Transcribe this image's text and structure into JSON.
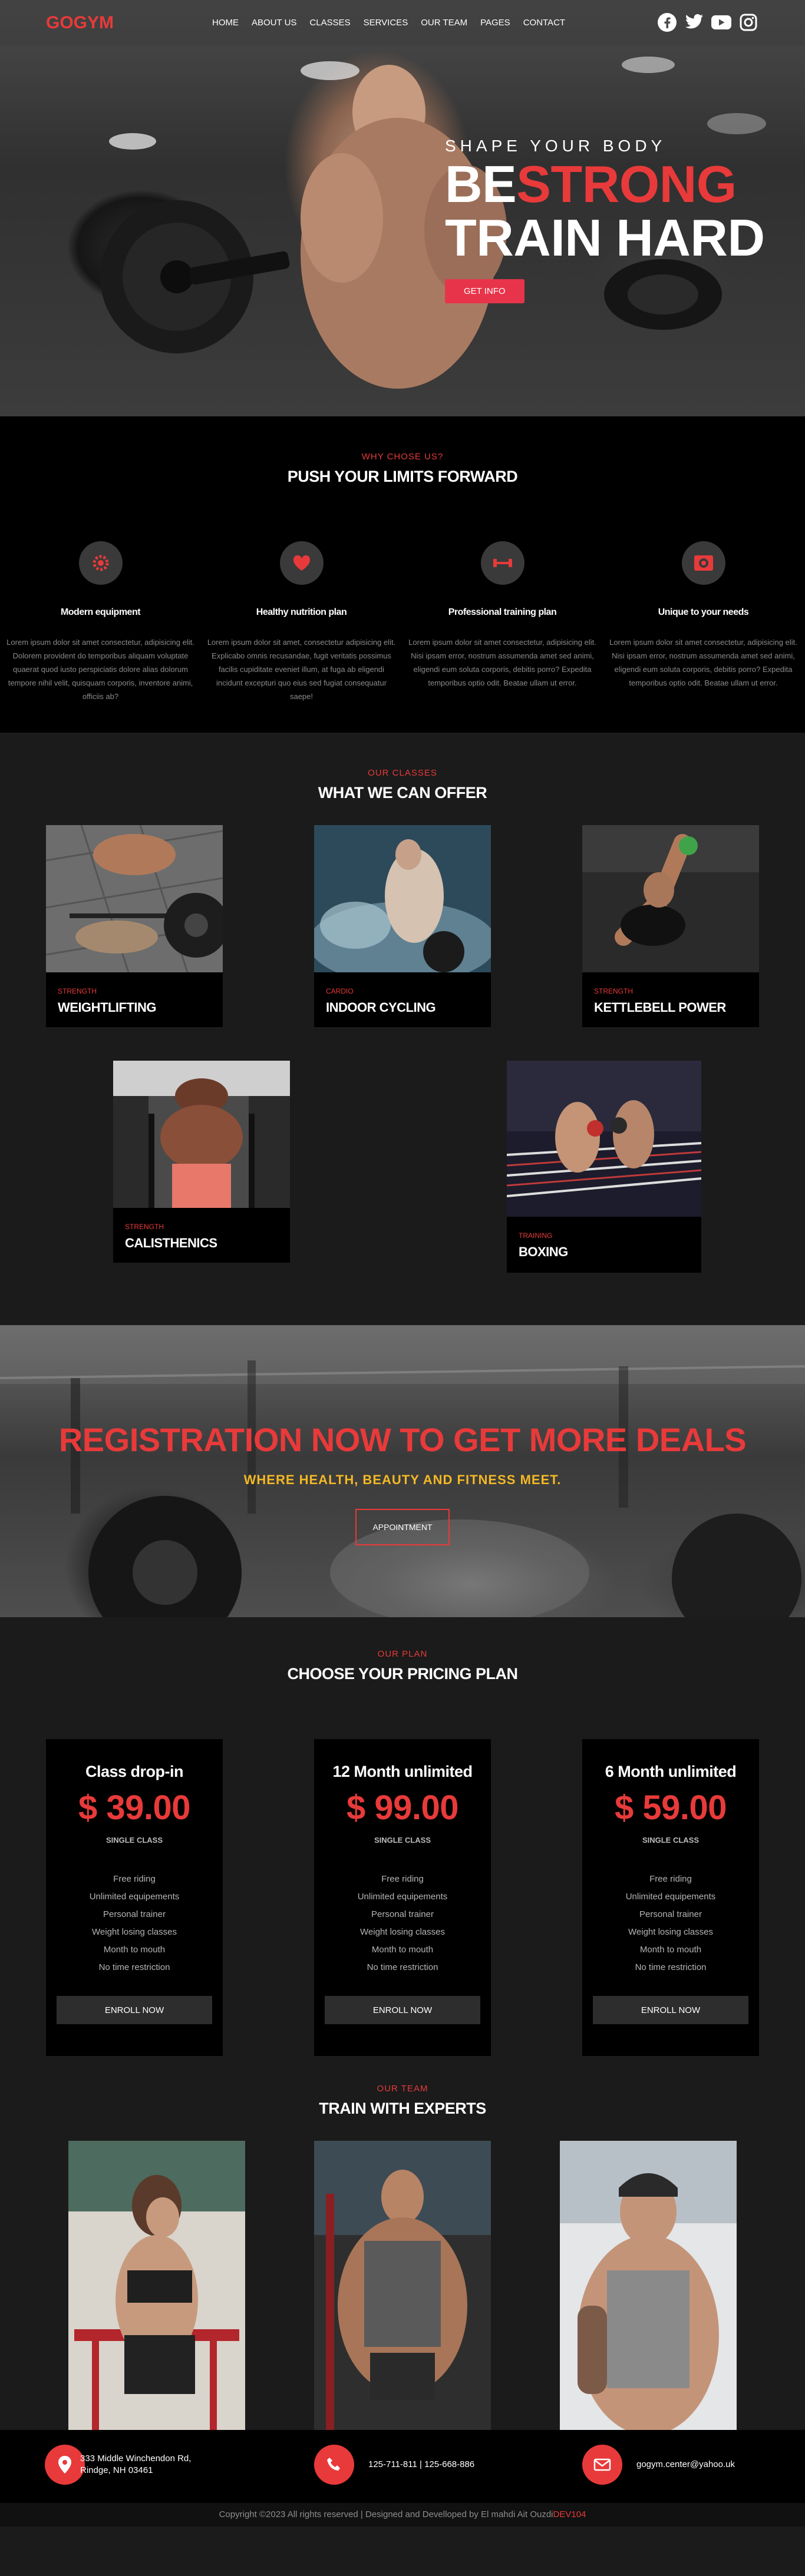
{
  "brand": {
    "logo": "GOGYM"
  },
  "nav": {
    "items": [
      "HOME",
      "ABOUT US",
      "CLASSES",
      "SERVICES",
      "OUR TEAM",
      "PAGES",
      "CONTACT"
    ],
    "social": [
      "facebook-icon",
      "twitter-icon",
      "youtube-icon",
      "instagram-icon"
    ]
  },
  "hero": {
    "kicker": "SHAPE YOUR BODY",
    "line1_a": "BE",
    "line1_b": "STRONG",
    "line2": "TRAIN HARD",
    "button": "GET INFO"
  },
  "why": {
    "kicker": "WHY CHOSE US?",
    "title": "PUSH YOUR LIMITS FORWARD",
    "features": [
      {
        "icon": "gear-icon",
        "title": "Modern equipment",
        "text": "Lorem ipsum dolor sit amet consectetur, adipisicing elit. Dolorem provident do temporibus aliquam voluptate quaerat quod iusto perspiciatis dolore alias dolorum tempore nihil velit, quisquam corporis, inventore animi, officiis ab?"
      },
      {
        "icon": "heart-icon",
        "title": "Healthy nutrition plan",
        "text": "Lorem ipsum dolor sit amet, consectetur adipisicing elit. Explicabo omnis recusandae, fugit veritatis possimus facilis cupiditate eveniet illum, at fuga ab eligendi incidunt excepturi quo eius sed fugiat consequatur saepe!"
      },
      {
        "icon": "dumbbell-icon",
        "title": "Professional training plan",
        "text": "Lorem ipsum dolor sit amet consectetur, adipisicing elit. Nisi ipsam error, nostrum assumenda amet sed animi, eligendi eum soluta corporis, debitis porro? Expedita temporibus optio odit. Beatae ullam ut error."
      },
      {
        "icon": "target-icon",
        "title": "Unique to your needs",
        "text": "Lorem ipsum dolor sit amet consectetur, adipisicing elit. Nisi ipsam error, nostrum assumenda amet sed animi, eligendi eum soluta corporis, debitis porro? Expedita temporibus optio odit. Beatae ullam ut error."
      }
    ]
  },
  "classes": {
    "kicker": "OUR CLASSES",
    "title": "WHAT WE CAN OFFER",
    "items": [
      {
        "category": "STRENGTH",
        "name": "WEIGHTLIFTING"
      },
      {
        "category": "CARDIO",
        "name": "INDOOR CYCLING"
      },
      {
        "category": "STRENGTH",
        "name": "KETTLEBELL POWER"
      },
      {
        "category": "STRENGTH",
        "name": "CALISTHENICS"
      },
      {
        "category": "TRAINING",
        "name": "BOXING"
      }
    ]
  },
  "register": {
    "title": "REGISTRATION NOW TO GET MORE DEALS",
    "subtitle": "WHERE HEALTH, BEAUTY AND FITNESS MEET.",
    "button": "APPOINTMENT"
  },
  "pricing": {
    "kicker": "OUR PLAN",
    "title": "CHOOSE YOUR PRICING PLAN",
    "plans": [
      {
        "name": "Class drop-in",
        "price": "$ 39.00",
        "type": "SINGLE CLASS",
        "features": [
          "Free riding",
          "Unlimited equipements",
          "Personal trainer",
          "Weight losing classes",
          "Month to mouth",
          "No time restriction"
        ],
        "button": "ENROLL NOW"
      },
      {
        "name": "12 Month unlimited",
        "price": "$ 99.00",
        "type": "SINGLE CLASS",
        "features": [
          "Free riding",
          "Unlimited equipements",
          "Personal trainer",
          "Weight losing classes",
          "Month to mouth",
          "No time restriction"
        ],
        "button": "ENROLL NOW"
      },
      {
        "name": "6 Month unlimited",
        "price": "$ 59.00",
        "type": "SINGLE CLASS",
        "features": [
          "Free riding",
          "Unlimited equipements",
          "Personal trainer",
          "Weight losing classes",
          "Month to mouth",
          "No time restriction"
        ],
        "button": "ENROLL NOW"
      }
    ]
  },
  "team": {
    "kicker": "OUR TEAM",
    "title": "TRAIN WITH EXPERTS"
  },
  "footer": {
    "address_line1": "333 Middle Winchendon Rd,",
    "address_line2": "Rindge, NH 03461",
    "phone": "125-711-811 | 125-668-886",
    "email": "gogym.center@yahoo.uk",
    "copyright": "Copyright ©2023 All rights reserved | Designed and Develloped by El mahdi Ait Ouzdi",
    "credit": "DEV104"
  },
  "colors": {
    "accent": "#e83a3a",
    "gold": "#f4b825",
    "dark": "#000000",
    "panel": "#1b1b1b"
  }
}
